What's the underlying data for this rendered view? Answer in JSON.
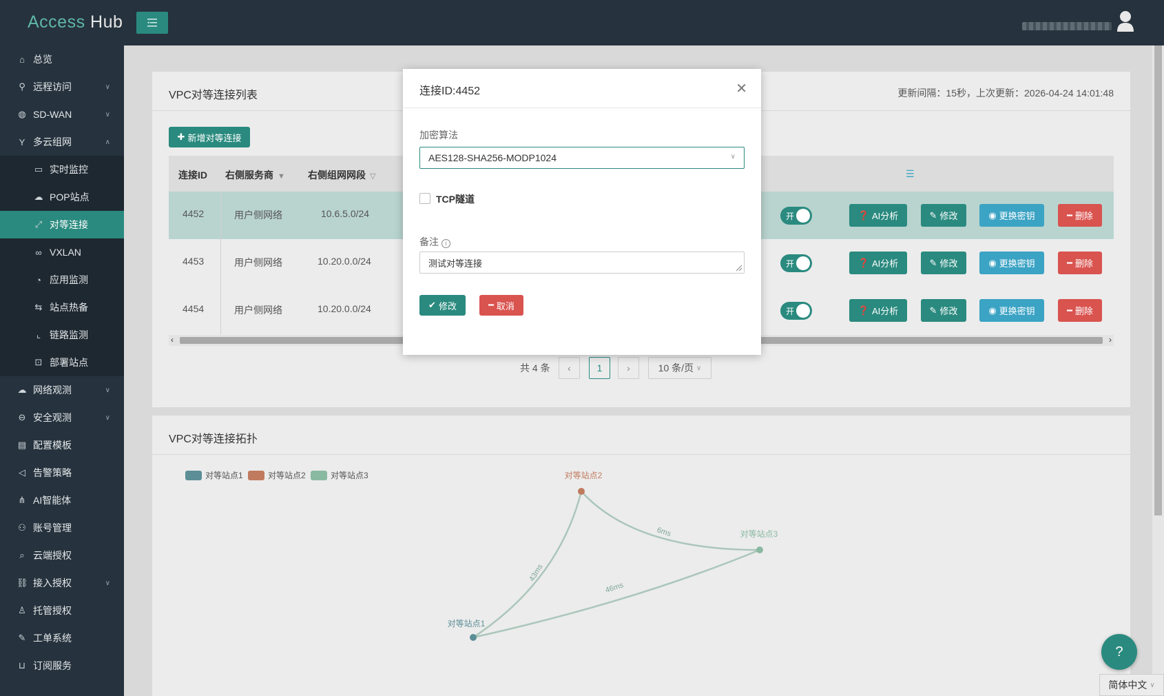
{
  "app": {
    "logo_access": "Access",
    "logo_hub": "Hub",
    "menu_icon": "menu-toggle-icon"
  },
  "sidebar": {
    "items": [
      {
        "label": "总览",
        "icon": "home-icon"
      },
      {
        "label": "远程访问",
        "icon": "pin-icon",
        "chevron": "expand"
      },
      {
        "label": "SD-WAN",
        "icon": "globe-icon",
        "chevron": "expand"
      },
      {
        "label": "多云组网",
        "icon": "branch-icon",
        "chevron": "collapse"
      },
      {
        "label": "实时监控",
        "icon": "monitor-icon",
        "sub": true
      },
      {
        "label": "POP站点",
        "icon": "cloud-icon",
        "sub": true
      },
      {
        "label": "对等连接",
        "icon": "link-diagonal-icon",
        "sub": true,
        "active": true
      },
      {
        "label": "VXLAN",
        "icon": "link-icon",
        "sub": true
      },
      {
        "label": "应用监测",
        "icon": "pie-icon",
        "sub": true
      },
      {
        "label": "站点热备",
        "icon": "swap-icon",
        "sub": true
      },
      {
        "label": "链路监测",
        "icon": "line-chart-icon",
        "sub": true
      },
      {
        "label": "部署站点",
        "icon": "box-icon",
        "sub": true
      },
      {
        "label": "网络观测",
        "icon": "cloud-icon",
        "chevron": "expand"
      },
      {
        "label": "安全观测",
        "icon": "minus-circle-icon",
        "chevron": "expand"
      },
      {
        "label": "配置模板",
        "icon": "file-icon"
      },
      {
        "label": "告警策略",
        "icon": "megaphone-icon"
      },
      {
        "label": "AI智能体",
        "icon": "network-icon"
      },
      {
        "label": "账号管理",
        "icon": "users-icon"
      },
      {
        "label": "云端授权",
        "icon": "search-icon"
      },
      {
        "label": "接入授权",
        "icon": "chain-icon",
        "chevron": "expand"
      },
      {
        "label": "托管授权",
        "icon": "user-icon"
      },
      {
        "label": "工单系统",
        "icon": "wrench-icon"
      },
      {
        "label": "订阅服务",
        "icon": "cart-icon"
      }
    ]
  },
  "list_panel": {
    "title": "VPC对等连接列表",
    "update_info": "更新间隔：15秒，上次更新：2026-04-24 14:01:48",
    "add_button": "新增对等连接",
    "headers": {
      "id": "连接ID",
      "right_provider": "右侧服务商",
      "right_segment": "右侧组网网段"
    },
    "rows": [
      {
        "id": "4452",
        "provider": "用户侧网络",
        "segment": "10.6.5.0/24",
        "toggle": "开",
        "highlight": true
      },
      {
        "id": "4453",
        "provider": "用户侧网络",
        "segment": "10.20.0.0/24",
        "toggle": "开"
      },
      {
        "id": "4454",
        "provider": "用户侧网络",
        "segment": "10.20.0.0/24",
        "toggle": "开"
      }
    ],
    "actions": {
      "ai": "AI分析",
      "edit": "修改",
      "rekey": "更换密钥",
      "delete": "删除"
    },
    "pager": {
      "total": "共 4 条",
      "page": "1",
      "size": "10 条/页"
    }
  },
  "topo_panel": {
    "title": "VPC对等连接拓扑",
    "legend": [
      {
        "name": "对等站点1",
        "color": "#5b8e96"
      },
      {
        "name": "对等站点2",
        "color": "#c07a5e"
      },
      {
        "name": "对等站点3",
        "color": "#8ab9a2"
      }
    ],
    "nodes": [
      {
        "name": "对等站点1"
      },
      {
        "name": "对等站点2"
      },
      {
        "name": "对等站点3"
      }
    ],
    "links": [
      {
        "label": "43ms"
      },
      {
        "label": "6ms"
      },
      {
        "label": "46ms"
      }
    ]
  },
  "modal": {
    "title": "连接ID:4452",
    "encrypt_label": "加密算法",
    "encrypt_value": "AES128-SHA256-MODP1024",
    "tcp_label": "TCP隧道",
    "tcp_checked": false,
    "note_label": "备注",
    "note_value": "测试对等连接",
    "save": "修改",
    "cancel": "取消"
  },
  "footer": {
    "language": "简体中文"
  },
  "colors": {
    "accent": "#2a8a7f",
    "danger": "#d9534f",
    "info": "#3ba3c4",
    "sidebar": "#26323d"
  }
}
